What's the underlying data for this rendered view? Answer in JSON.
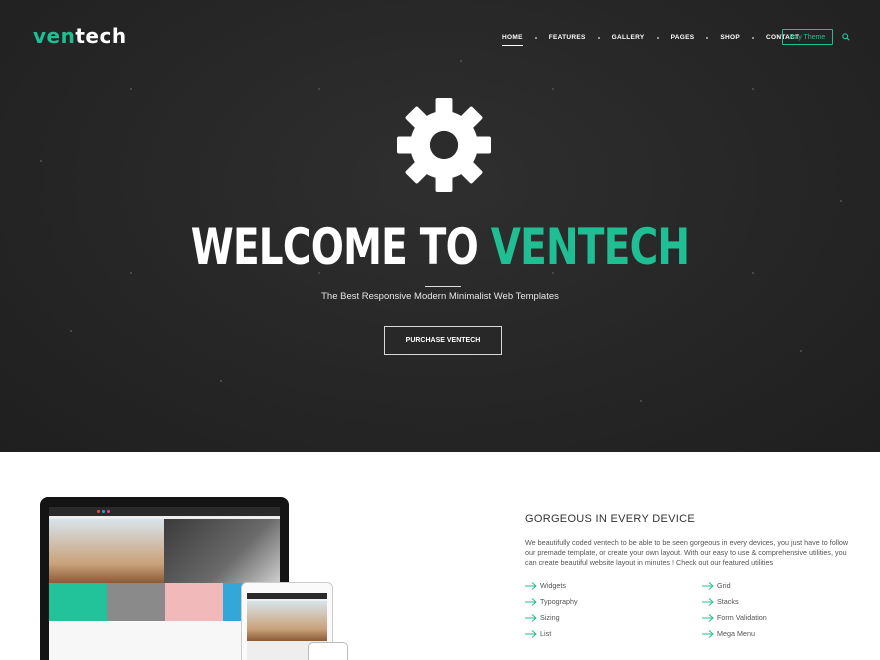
{
  "brand": {
    "logo_prefix": "ven",
    "logo_suffix": "tech",
    "accent": "#1fbf93"
  },
  "nav": {
    "items": [
      {
        "label": "Home",
        "active": true
      },
      {
        "label": "Features",
        "active": false
      },
      {
        "label": "Gallery",
        "active": false
      },
      {
        "label": "Pages",
        "active": false
      },
      {
        "label": "Shop",
        "active": false
      },
      {
        "label": "Contact",
        "active": false
      }
    ],
    "buy_label": "Buy Theme",
    "search_icon": "search-icon"
  },
  "hero": {
    "icon": "gear-icon",
    "title_white": "WELCOME TO ",
    "title_accent": "VENTECH",
    "subtitle": "The Best Responsive Modern Minimalist Web Templates",
    "button_label": "PURCHASE VENTECH"
  },
  "devices_section": {
    "title": "GORGEOUS IN EVERY DEVICE",
    "description": "We beautifully coded ventech to be able to be seen gorgeous in every devices, you just have to follow our premade template, or create your own layout. With our easy to use & comprehensive utilities, you can create beautiful website layout in minutes ! Check out our featured utilities",
    "features_left": [
      "Widgets",
      "Typography",
      "Sizing",
      "List"
    ],
    "features_right": [
      "Grid",
      "Stacks",
      "Form Validation",
      "Mega Menu"
    ],
    "feature_icon": "arrow-right-icon"
  }
}
